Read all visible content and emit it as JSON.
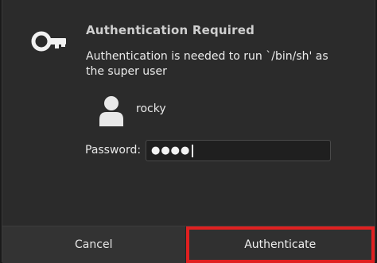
{
  "dialog": {
    "title": "Authentication Required",
    "message": "Authentication is needed to run `/bin/sh' as the super user",
    "icon": "key-icon"
  },
  "user": {
    "name": "rocky",
    "avatar_icon": "person-icon"
  },
  "password": {
    "label": "Password:",
    "masked_value": "●●●●"
  },
  "buttons": {
    "cancel_label": "Cancel",
    "authenticate_label": "Authenticate"
  },
  "colors": {
    "highlight": "#e02020",
    "background": "#2b2b2b"
  }
}
